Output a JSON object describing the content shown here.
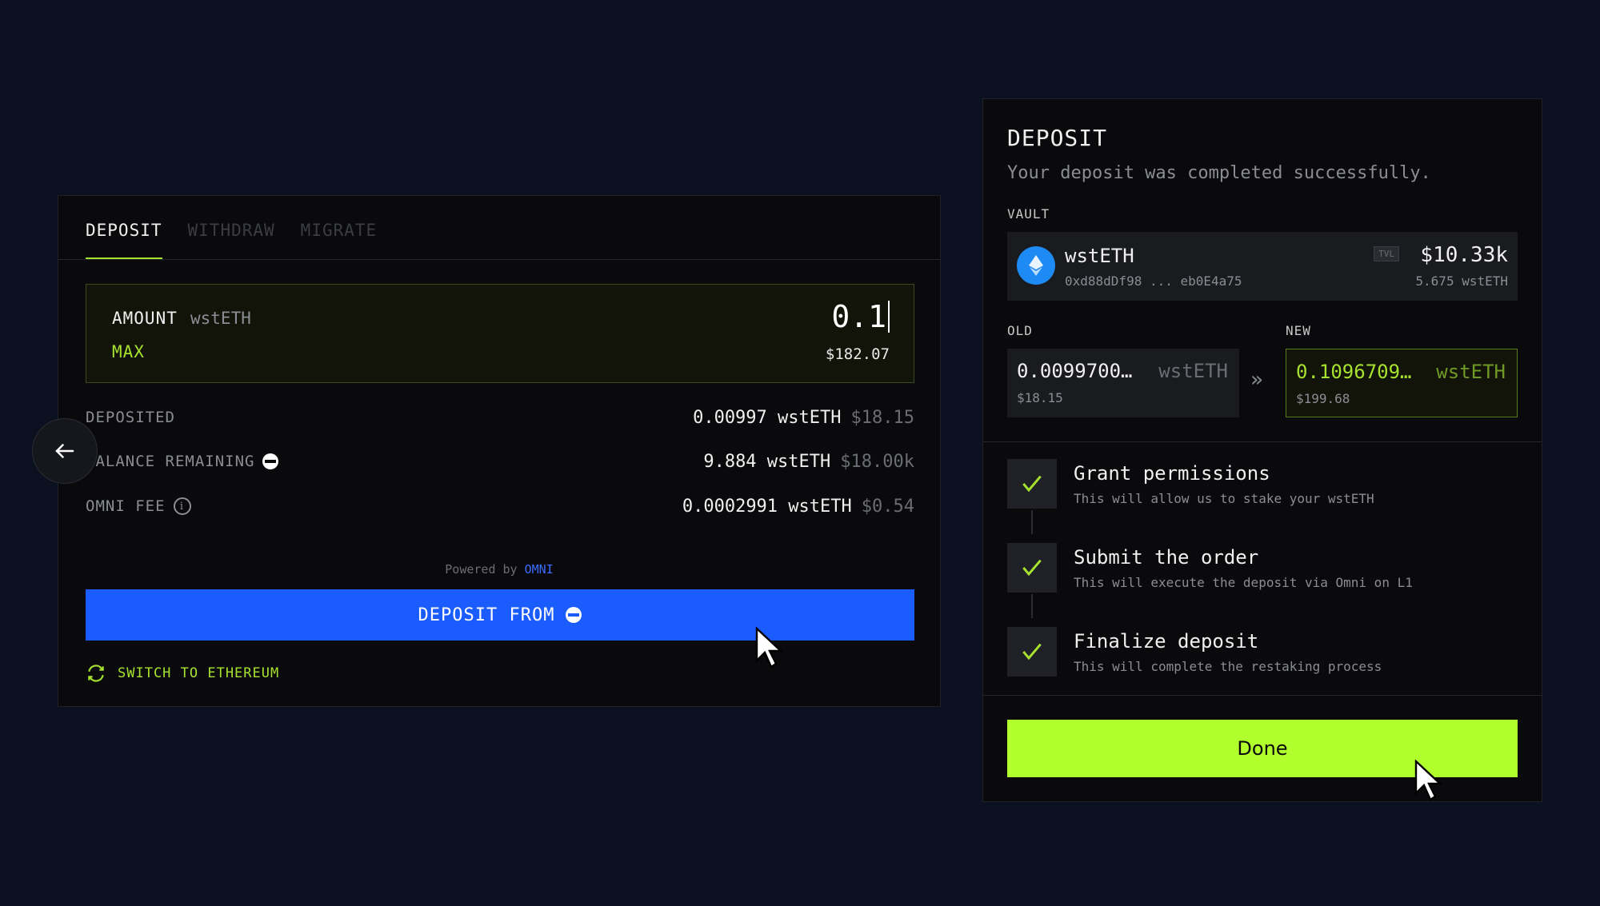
{
  "left_panel": {
    "tabs": [
      {
        "label": "DEPOSIT"
      },
      {
        "label": "WITHDRAW"
      },
      {
        "label": "MIGRATE"
      }
    ],
    "amount": {
      "label": "AMOUNT",
      "token": "wstETH",
      "max_label": "MAX",
      "value": "0.1",
      "usd": "$182.07"
    },
    "rows": [
      {
        "label": "DEPOSITED",
        "value": "0.00997 wstETH",
        "usd": "$18.15"
      },
      {
        "label": "BALANCE REMAINING",
        "value": "9.884 wstETH",
        "usd": "$18.00k"
      },
      {
        "label": "OMNI FEE",
        "value": "0.0002991 wstETH",
        "usd": "$0.54"
      }
    ],
    "powered_by": "Powered by",
    "powered_brand": "OMNI",
    "deposit_button": "DEPOSIT FROM",
    "switch_link": "SWITCH TO ETHEREUM"
  },
  "right_panel": {
    "title": "DEPOSIT",
    "subtitle": "Your deposit was completed successfully.",
    "vault_label": "VAULT",
    "vault": {
      "name": "wstETH",
      "address": "0xd88dDf98 ... eb0E4a75",
      "tvl_badge": "TVL",
      "tvl": "$10.33k",
      "amount": "5.675 wstETH"
    },
    "old_label": "OLD",
    "new_label": "NEW",
    "old": {
      "value": "0.0099700…",
      "token": "wstETH",
      "usd": "$18.15"
    },
    "new": {
      "value": "0.1096709…",
      "token": "wstETH",
      "usd": "$199.68"
    },
    "steps": [
      {
        "title": "Grant permissions",
        "desc": "This will allow us to stake your wstETH"
      },
      {
        "title": "Submit the order",
        "desc": "This will execute the deposit via Omni on L1"
      },
      {
        "title": "Finalize deposit",
        "desc": "This will complete the restaking process"
      }
    ],
    "done_button": "Done"
  },
  "colors": {
    "background": "#0b1120",
    "accent_green": "#a6e22e",
    "done_green": "#b2ff2e",
    "deposit_blue": "#1b5cff"
  }
}
